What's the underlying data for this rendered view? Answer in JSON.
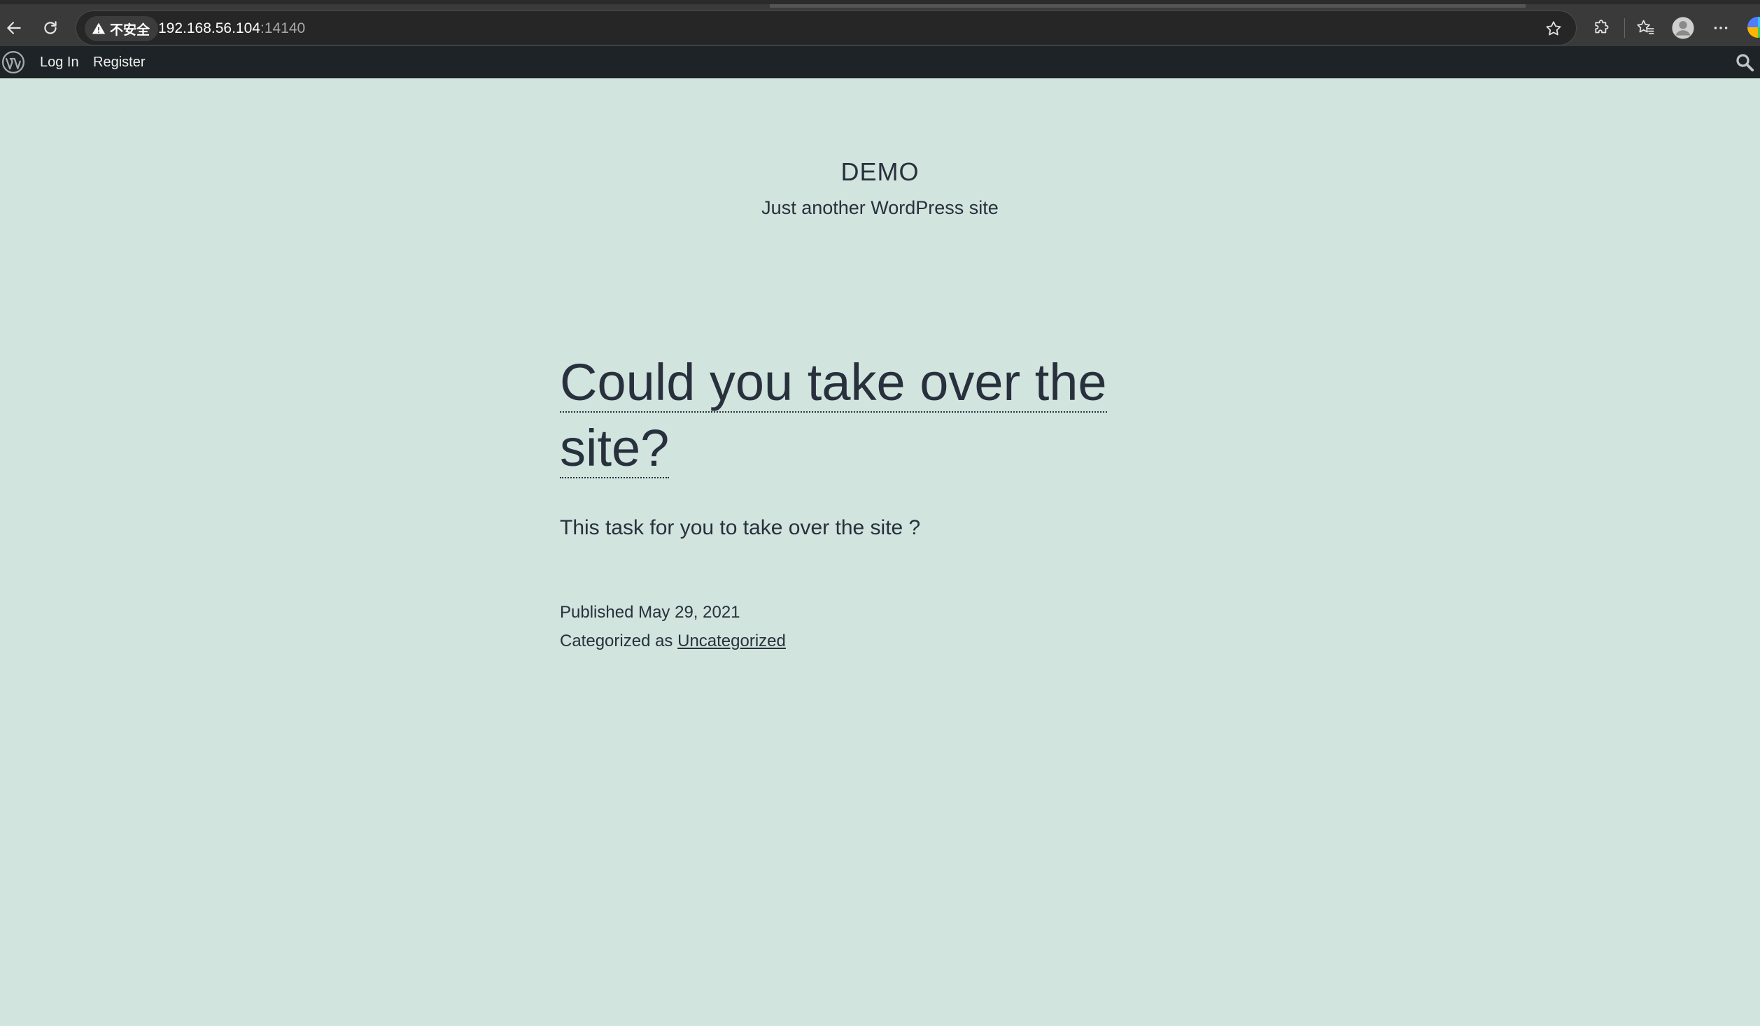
{
  "browser": {
    "security_label": "不安全",
    "url_host": "192.168.56.104",
    "url_port": ":14140",
    "icons": [
      "back-arrow-icon",
      "reload-icon",
      "warning-icon",
      "star-icon",
      "extensions-icon",
      "favorites-icon",
      "profile-icon",
      "more-icon",
      "edge-icon"
    ]
  },
  "admin_bar": {
    "login_label": "Log In",
    "register_label": "Register"
  },
  "site": {
    "title": "DEMO",
    "description": "Just another WordPress site"
  },
  "post": {
    "title_line1": "Could you take over the",
    "title_line2": "site?",
    "body": "This task for you to take over the site ?",
    "published_prefix": "Published",
    "published_date": "May 29, 2021",
    "category_prefix": "Categorized as",
    "category": "Uncategorized"
  },
  "colors": {
    "background": "#d1e4dd",
    "text": "#28303d",
    "admin_bar": "#1d2327"
  }
}
